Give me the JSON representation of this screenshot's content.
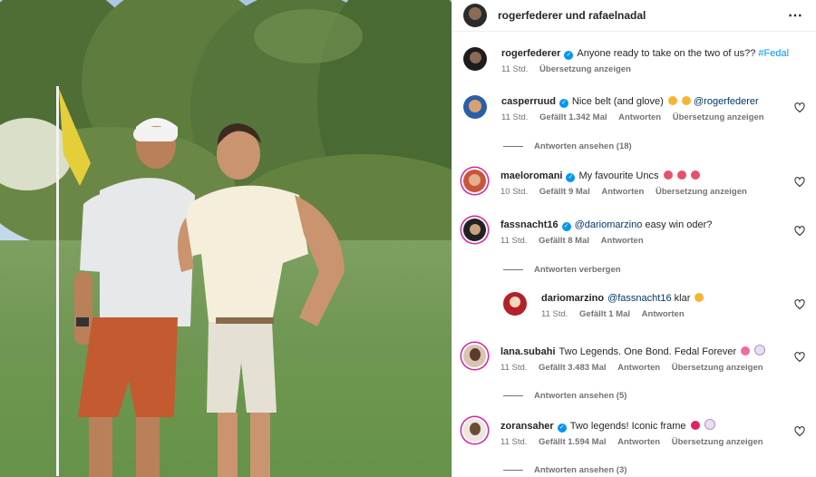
{
  "header": {
    "title": "rogerfederer und rafaelnadal",
    "more_icon": "⋯"
  },
  "post": {
    "user": "rogerfederer",
    "text": "Anyone ready to take on the two of us??",
    "hashtag": "#Fedal",
    "time": "11 Std.",
    "translate": "Übersetzung anzeigen"
  },
  "comments": [
    {
      "user": "casperruud",
      "text": "Nice belt (and glove)",
      "mention": "@rogerfederer",
      "time": "11 Std.",
      "likes": "Gefällt 1.342 Mal",
      "reply": "Antworten",
      "translate": "Übersetzung anzeigen",
      "replies": "Antworten ansehen (18)"
    },
    {
      "user": "maeloromani",
      "text": "My favourite Uncs",
      "time": "10 Std.",
      "likes": "Gefällt 9 Mal",
      "reply": "Antworten",
      "translate": "Übersetzung anzeigen"
    },
    {
      "user": "fassnacht16",
      "mention": "@dariomarzino",
      "text": "easy win oder?",
      "time": "11 Std.",
      "likes": "Gefällt 8 Mal",
      "reply": "Antworten",
      "replies": "Antworten verbergen"
    },
    {
      "user": "dariomarzino",
      "mention": "@fassnacht16",
      "text": "klar",
      "time": "11 Std.",
      "likes": "Gefällt 1 Mal",
      "reply": "Antworten"
    },
    {
      "user": "lana.subahi",
      "text": "Two Legends. One Bond. Fedal Forever",
      "time": "11 Std.",
      "likes": "Gefällt 3.483 Mal",
      "reply": "Antworten",
      "translate": "Übersetzung anzeigen",
      "replies": "Antworten ansehen (5)"
    },
    {
      "user": "zoransaher",
      "text": "Two legends! Iconic frame",
      "time": "11 Std.",
      "likes": "Gefällt 1.594 Mal",
      "reply": "Antworten",
      "translate": "Übersetzung anzeigen",
      "replies": "Antworten ansehen (3)"
    }
  ],
  "colors": {
    "verified": "#0095f6",
    "link": "#00376b",
    "meta": "#737373",
    "ring": "#d6249f"
  }
}
